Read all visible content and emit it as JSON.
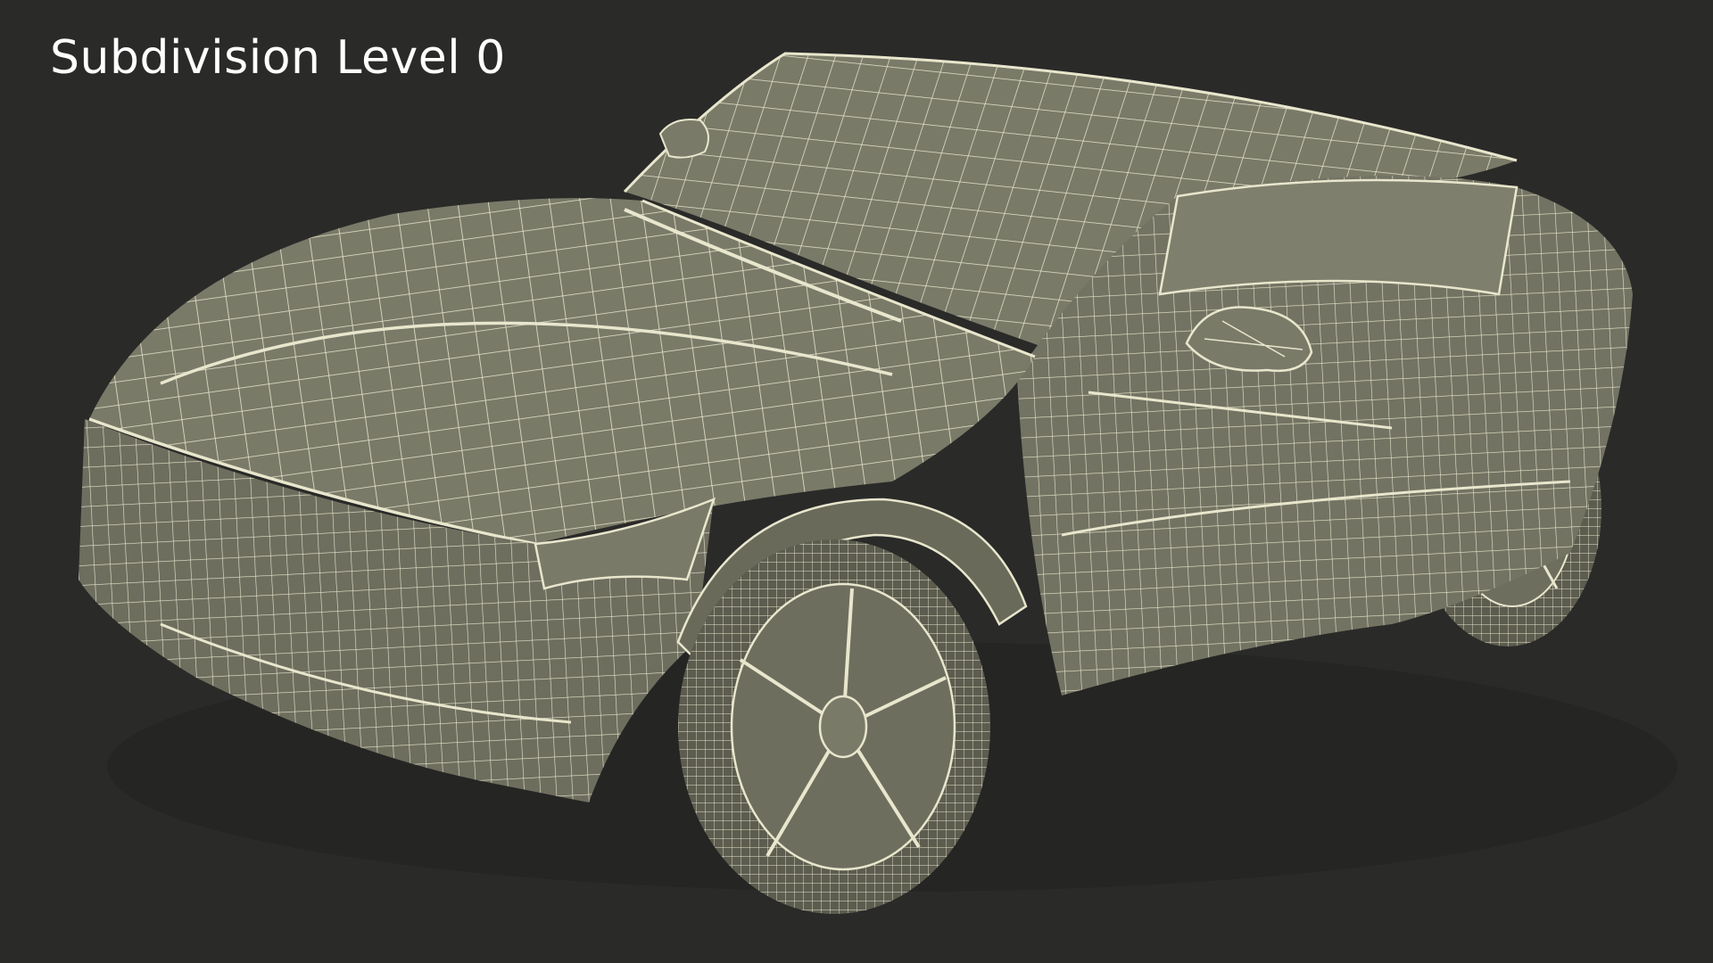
{
  "caption": {
    "text": "Subdivision Level 0"
  },
  "render": {
    "subject": "car-wireframe",
    "background_color": "#2a2a29",
    "surface_color": "#7a7a69",
    "shadow_color": "#5c5c4f",
    "wire_color": "#e8e6cc",
    "caption_color": "#ffffff"
  }
}
